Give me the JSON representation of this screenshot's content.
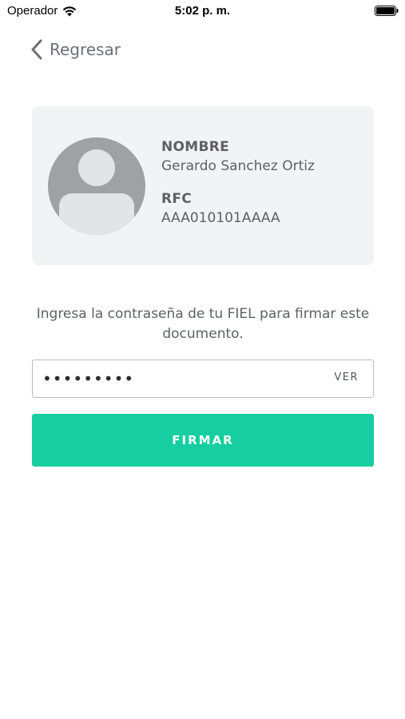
{
  "status_bar": {
    "carrier": "Operador",
    "time": "5:02 p. m."
  },
  "nav": {
    "back_label": "Regresar"
  },
  "profile": {
    "name_label": "NOMBRE",
    "name_value": "Gerardo Sanchez Ortiz",
    "rfc_label": "RFC",
    "rfc_value": "AAA010101AAAA"
  },
  "instructions": "Ingresa la contraseña de tu FIEL para firmar este documento.",
  "password": {
    "masked_value": "•••••••••",
    "show_label": "VER"
  },
  "sign_button": {
    "label": "FIRMAR"
  },
  "colors": {
    "accent": "#16ce9f",
    "card_background": "#f2f3f5",
    "text": "#5d6166"
  },
  "icons": [
    "wifi-icon",
    "battery-icon",
    "chevron-left-icon",
    "avatar-placeholder-icon"
  ]
}
